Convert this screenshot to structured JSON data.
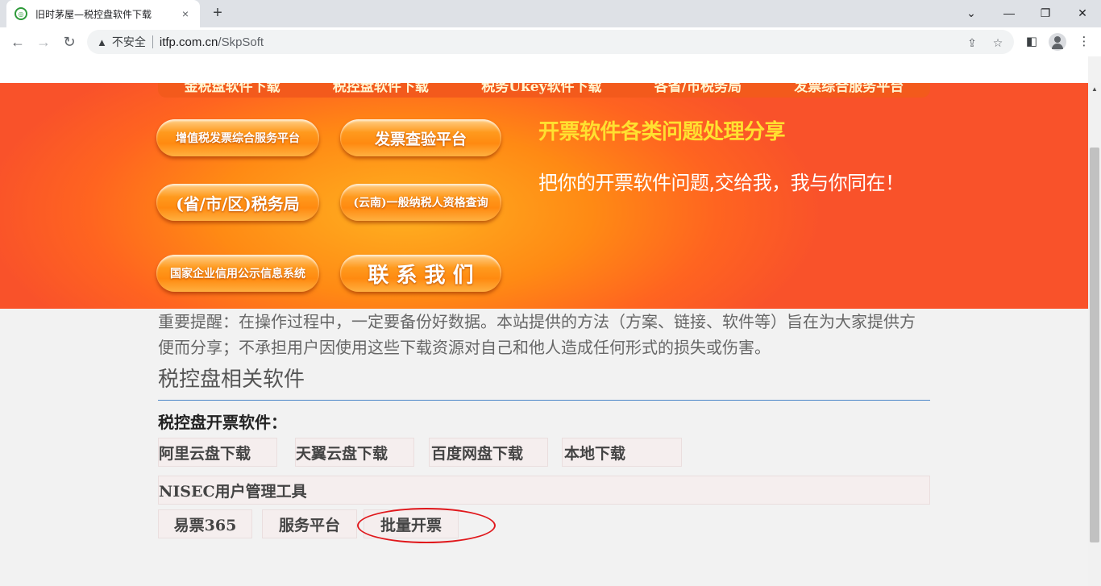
{
  "browser": {
    "tab_title": "旧时茅屋—税控盘软件下载",
    "tab_close": "×",
    "new_tab": "+",
    "insecure_label": "不安全",
    "url_host": "itfp.com.cn",
    "url_path": "/SkpSoft"
  },
  "banner": {
    "top_nav": [
      "金税盘软件下载",
      "税控盘软件下载",
      "税务Ukey软件下载",
      "各省/市税务局",
      "发票综合服务平台"
    ],
    "pills": {
      "vat_platform": "增值税发票综合服务平台",
      "invoice_check": "发票查验平台",
      "tax_bureau": "(省/市/区)税务局",
      "yunnan_query": "(云南)一般纳税人资格查询",
      "credit_system": "国家企业信用公示信息系统",
      "contact": "联 系 我 们"
    },
    "headline": "开票软件各类问题处理分享",
    "slogan": "把你的开票软件问题,交给我，我与你同在！"
  },
  "content": {
    "notice": "重要提醒：在操作过程中，一定要备份好数据。本站提供的方法（方案、链接、软件等）旨在为大家提供方便而分享；不承担用户因使用这些下载资源对自己和他人造成任何形式的损失或伤害。",
    "section_title": "税控盘相关软件",
    "sub_title": "税控盘开票软件：",
    "download_buttons": [
      "阿里云盘下载",
      "天翼云盘下载",
      "百度网盘下载",
      "本地下载"
    ],
    "tool_row": "NISEC用户管理工具",
    "tool_buttons": [
      "易票365",
      "服务平台",
      "批量开票"
    ]
  },
  "colors": {
    "banner_orange": "#ff8a14",
    "headline_yellow": "#ffe030",
    "rule_blue": "#4a86c8",
    "annotation_red": "#e0181c"
  }
}
